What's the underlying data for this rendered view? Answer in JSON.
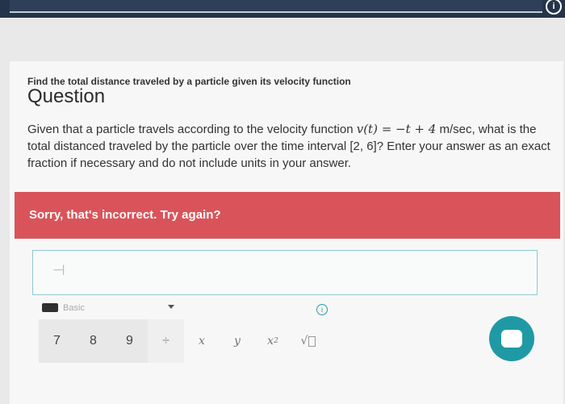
{
  "page": {
    "subtitle": "Find the total distance traveled by a particle given its velocity function",
    "heading": "Question",
    "prompt": {
      "part1": "Given that a particle travels according to the velocity function ",
      "function": "v(t) = −t + 4",
      "part2": " m/sec, what is the total distanced traveled by the particle over the time interval ",
      "interval": "[2, 6]",
      "part3": "? Enter your answer as an exact fraction if necessary and do not include units in your answer."
    },
    "alert": "Sorry, that's incorrect. Try again?"
  },
  "answer": {
    "value": ""
  },
  "keyboard": {
    "mode_label": "Basic",
    "info_symbol": "i",
    "keys": {
      "k7": "7",
      "k8": "8",
      "k9": "9",
      "divide": "÷",
      "x": "x",
      "y": "y",
      "x_squared_base": "x",
      "x_squared_exp": "2",
      "sqrt": "√"
    }
  },
  "colors": {
    "alert_bg": "#d9545a",
    "accent": "#1f9aa5",
    "topbar": "#24344a"
  },
  "icons": {
    "top_right": "info-circle-icon",
    "keyboard": "keyboard-icon",
    "chat": "chat-icon"
  }
}
